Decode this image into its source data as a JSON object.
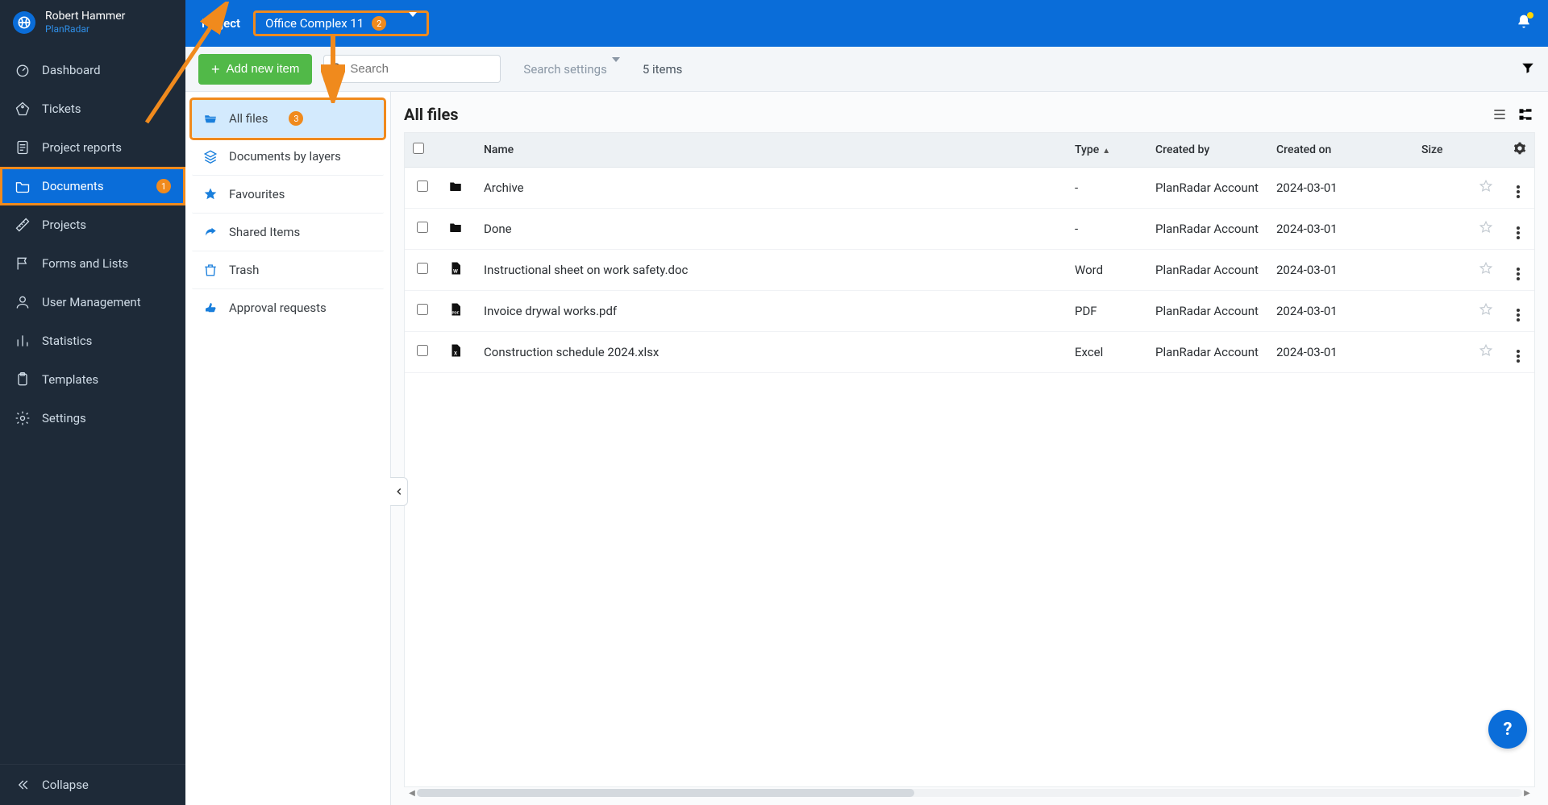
{
  "user": {
    "name": "Robert Hammer",
    "brand": "PlanRadar"
  },
  "topbar": {
    "project_label": "Project",
    "project_name": "Office Complex 11",
    "project_badge": "2"
  },
  "toolbar": {
    "add_label": "Add new item",
    "search_placeholder": "Search",
    "search_settings_label": "Search settings",
    "items_count": "5 items"
  },
  "sidebar": {
    "collapse_label": "Collapse",
    "items": [
      {
        "label": "Dashboard",
        "icon": "gauge"
      },
      {
        "label": "Tickets",
        "icon": "tag"
      },
      {
        "label": "Project reports",
        "icon": "report"
      },
      {
        "label": "Documents",
        "icon": "folder",
        "active": true,
        "badge": "1"
      },
      {
        "label": "Projects",
        "icon": "ruler"
      },
      {
        "label": "Forms and Lists",
        "icon": "flag"
      },
      {
        "label": "User Management",
        "icon": "user"
      },
      {
        "label": "Statistics",
        "icon": "stats"
      },
      {
        "label": "Templates",
        "icon": "clipboard"
      },
      {
        "label": "Settings",
        "icon": "gear"
      }
    ]
  },
  "tree": {
    "items": [
      {
        "label": "All files",
        "icon": "folder-open",
        "active": true,
        "badge": "3"
      },
      {
        "label": "Documents by layers",
        "icon": "layers"
      },
      {
        "label": "Favourites",
        "icon": "star"
      },
      {
        "label": "Shared Items",
        "icon": "share"
      },
      {
        "label": "Trash",
        "icon": "trash"
      },
      {
        "label": "Approval requests",
        "icon": "approve"
      }
    ]
  },
  "table": {
    "title": "All files",
    "columns": {
      "name": "Name",
      "type": "Type",
      "created_by": "Created by",
      "created_on": "Created on",
      "size": "Size"
    },
    "rows": [
      {
        "icon": "folder",
        "name": "Archive",
        "type": "-",
        "created_by": "PlanRadar Account",
        "created_on": "2024-03-01",
        "size": ""
      },
      {
        "icon": "folder",
        "name": "Done",
        "type": "-",
        "created_by": "PlanRadar Account",
        "created_on": "2024-03-01",
        "size": ""
      },
      {
        "icon": "doc-w",
        "name": "Instructional sheet on work safety.doc",
        "type": "Word",
        "created_by": "PlanRadar Account",
        "created_on": "2024-03-01",
        "size": ""
      },
      {
        "icon": "doc-pdf",
        "name": "Invoice drywal works.pdf",
        "type": "PDF",
        "created_by": "PlanRadar Account",
        "created_on": "2024-03-01",
        "size": ""
      },
      {
        "icon": "doc-x",
        "name": "Construction schedule 2024.xlsx",
        "type": "Excel",
        "created_by": "PlanRadar Account",
        "created_on": "2024-03-01",
        "size": ""
      }
    ]
  },
  "help": {
    "label": "?"
  }
}
